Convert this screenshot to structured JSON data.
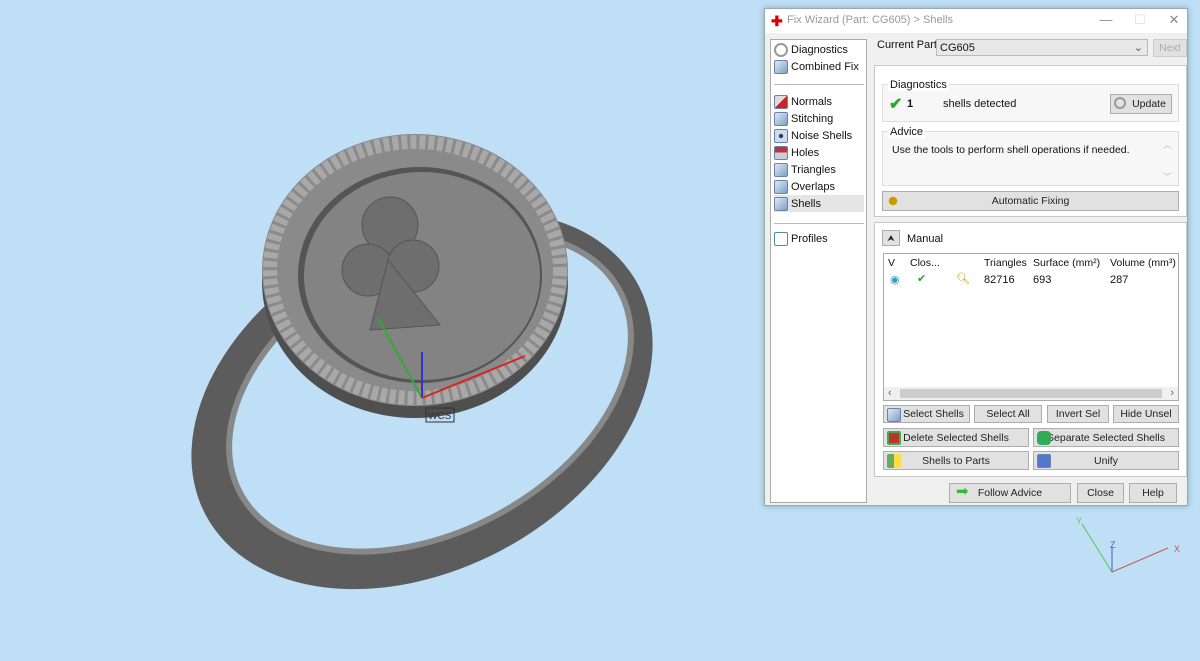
{
  "viewport": {
    "wcs_label": "WCS",
    "axis_x": "X",
    "axis_y": "Y",
    "axis_z": "Z",
    "colors": {
      "background": "#bedff6",
      "ring": "#6e6e6e"
    }
  },
  "dialog": {
    "title": "Fix Wizard (Part: CG605) > Shells",
    "nav": {
      "items": [
        {
          "label": "Diagnostics",
          "icon": "magnifier-icon"
        },
        {
          "label": "Combined Fix",
          "icon": "cube-icon"
        },
        {
          "label": "Normals",
          "icon": "cube-red-icon"
        },
        {
          "label": "Stitching",
          "icon": "cube-icon"
        },
        {
          "label": "Noise Shells",
          "icon": "noise-icon"
        },
        {
          "label": "Holes",
          "icon": "cube-red-icon"
        },
        {
          "label": "Triangles",
          "icon": "triangle-cube-icon"
        },
        {
          "label": "Overlaps",
          "icon": "cube-icon"
        },
        {
          "label": "Shells",
          "icon": "cube-icon"
        },
        {
          "label": "Profiles",
          "icon": "document-icon"
        }
      ],
      "selected": "Shells"
    },
    "current_part_label": "Current Part:",
    "current_part_value": "CG605",
    "next_label": "Next",
    "diagnostics": {
      "title": "Diagnostics",
      "count": "1",
      "text": "shells detected",
      "update_label": "Update"
    },
    "advice": {
      "title": "Advice",
      "text": "Use the tools to perform shell operations if needed."
    },
    "automatic_fixing_label": "Automatic Fixing",
    "manual": {
      "label": "Manual",
      "columns": [
        "V",
        "Clos...",
        "",
        "Triangles",
        "Surface (mm²)",
        "Volume (mm³)"
      ],
      "rows": [
        {
          "triangles": "82716",
          "surface": "693",
          "volume": "287"
        }
      ],
      "buttons": {
        "select_shells": "Select Shells",
        "select_all": "Select All",
        "invert_sel": "Invert Sel",
        "hide_unsel": "Hide Unsel",
        "delete_selected": "Delete Selected Shells",
        "separate_selected": "Separate Selected Shells",
        "shells_to_parts": "Shells to Parts",
        "unify": "Unify"
      }
    },
    "footer": {
      "follow_advice": "Follow Advice",
      "close": "Close",
      "help": "Help"
    }
  }
}
